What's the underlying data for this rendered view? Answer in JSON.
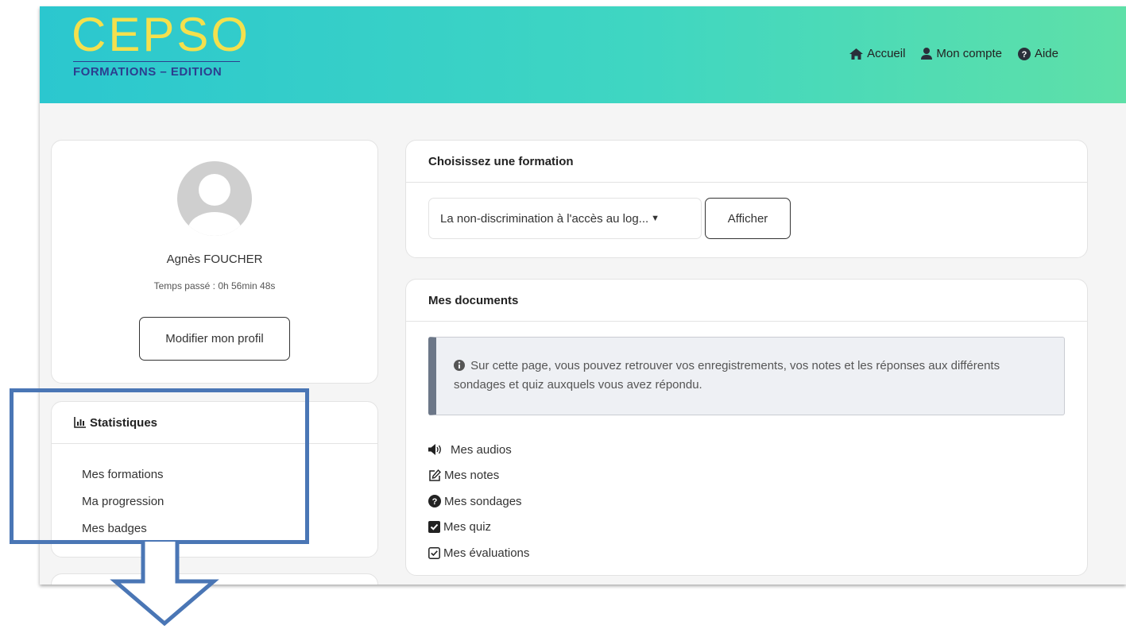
{
  "brand": {
    "logo_text": "CEPSO",
    "logo_subtitle": "FORMATIONS – EDITION",
    "logo_color": "#f4e04d",
    "subtitle_color": "#2c3e8f"
  },
  "nav": {
    "home_label": "Accueil",
    "account_label": "Mon compte",
    "help_label": "Aide"
  },
  "profile": {
    "name": "Agnès FOUCHER",
    "time_spent": "Temps passé : 0h 56min 48s",
    "edit_button": "Modifier mon profil"
  },
  "stats": {
    "title": "Statistiques",
    "links": [
      "Mes formations",
      "Ma progression",
      "Mes badges"
    ]
  },
  "formation": {
    "title": "Choisissez une formation",
    "selected": "La non-discrimination à l'accès au log...",
    "show_button": "Afficher"
  },
  "documents": {
    "title": "Mes documents",
    "info": "Sur cette page, vous pouvez retrouver vos enregistrements, vos notes et les réponses aux différents sondages et quiz auxquels vous avez répondu.",
    "items": [
      {
        "icon": "speaker-icon",
        "label": "Mes audios"
      },
      {
        "icon": "edit-icon",
        "label": "Mes notes"
      },
      {
        "icon": "question-circle-icon",
        "label": "Mes sondages"
      },
      {
        "icon": "check-square-filled-icon",
        "label": "Mes quiz"
      },
      {
        "icon": "check-square-outline-icon",
        "label": "Mes évaluations"
      }
    ]
  },
  "colors": {
    "header_gradient_start": "#2bc7cf",
    "header_gradient_end": "#5ee0a8",
    "annotation_blue": "#4a76b5"
  }
}
